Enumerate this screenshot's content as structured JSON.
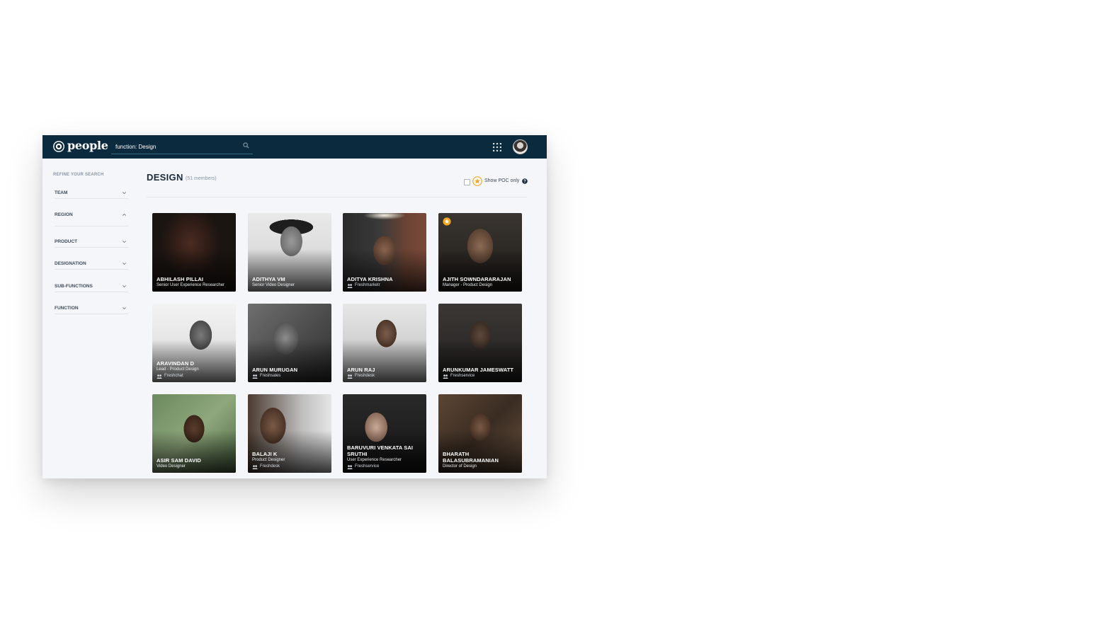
{
  "app": {
    "name": "people"
  },
  "search": {
    "value": "function: Design"
  },
  "sidebar": {
    "title": "REFINE YOUR SEARCH",
    "filters": [
      {
        "label": "TEAM",
        "state": "collapsed"
      },
      {
        "label": "REGION",
        "state": "expanded"
      },
      {
        "label": "PRODUCT",
        "state": "collapsed"
      },
      {
        "label": "DESIGNATION",
        "state": "collapsed"
      },
      {
        "label": "SUB-FUNCTIONS",
        "state": "collapsed"
      },
      {
        "label": "FUNCTION",
        "state": "collapsed"
      }
    ]
  },
  "main": {
    "title": "DESIGN",
    "member_count": "(51 members)",
    "poc_toggle": {
      "label": "Show POC only",
      "checked": false
    }
  },
  "colors": {
    "topbar": "#0c2a3e",
    "accent_orange": "#f5a623",
    "background": "#f5f6fa"
  },
  "people": [
    {
      "name": "ABHILASH PILLAI",
      "role": "Senior User Experience Researcher",
      "team": "",
      "poc": false
    },
    {
      "name": "ADITHYA VM",
      "role": "Senior Video Designer",
      "team": "",
      "poc": false
    },
    {
      "name": "ADITYA KRISHNA",
      "role": "",
      "team": "Freshmarketr",
      "poc": false
    },
    {
      "name": "AJITH SOWNDARARAJAN",
      "role": "Manager - Product Design",
      "team": "",
      "poc": true
    },
    {
      "name": "ARAVINDAN D",
      "role": "Lead - Product Design",
      "team": "Freshchat",
      "poc": false
    },
    {
      "name": "ARUN MURUGAN",
      "role": "",
      "team": "Freshsales",
      "poc": false
    },
    {
      "name": "ARUN RAJ",
      "role": "",
      "team": "Freshdesk",
      "poc": false
    },
    {
      "name": "ARUNKUMAR JAMESWATT",
      "role": "",
      "team": "Freshservice",
      "poc": false
    },
    {
      "name": "ASIR SAM DAVID",
      "role": "Video Designer",
      "team": "",
      "poc": false
    },
    {
      "name": "BALAJI K",
      "role": "Product Designer",
      "team": "Freshdesk",
      "poc": false
    },
    {
      "name": "BARUVURI VENKATA SAI SRUTHI",
      "role": "User Experience Researcher",
      "team": "Freshservice",
      "poc": false
    },
    {
      "name": "BHARATH BALASUBRAMANIAN",
      "role": "Director of Design",
      "team": "",
      "poc": false
    }
  ]
}
